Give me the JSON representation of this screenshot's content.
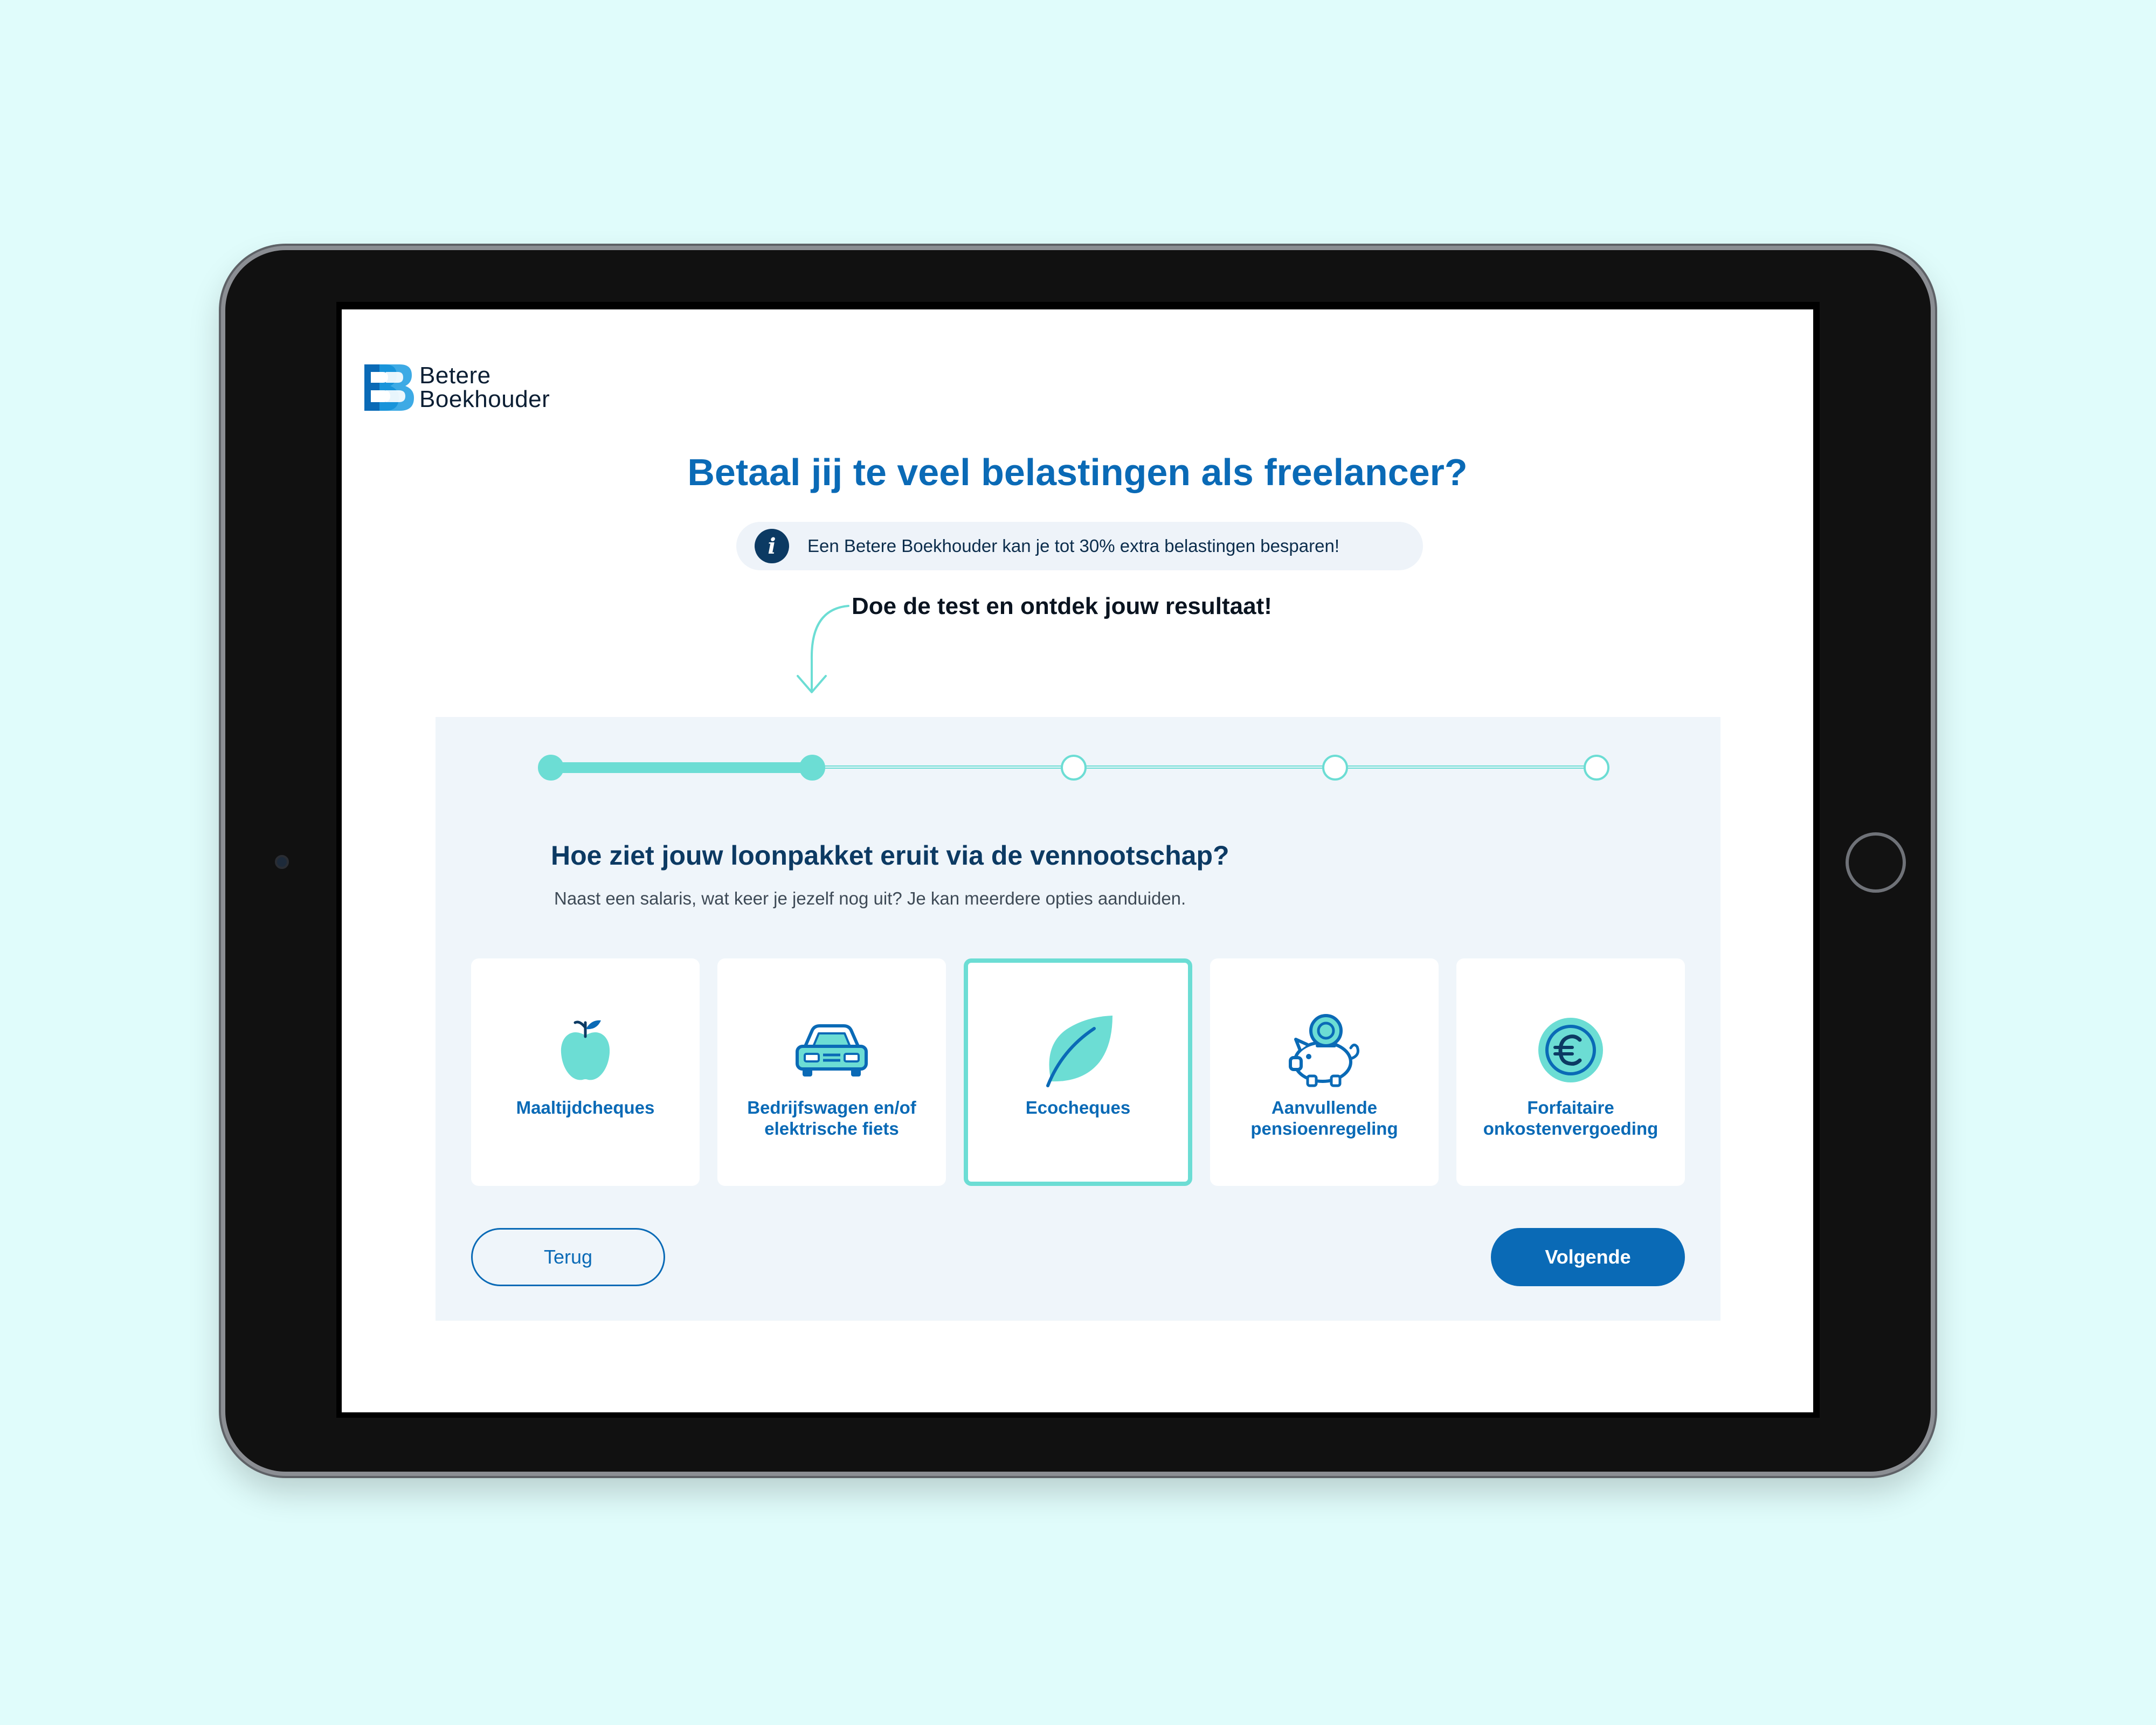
{
  "logo": {
    "line1": "Betere",
    "line2": "Boekhouder"
  },
  "headline": "Betaal jij te veel belastingen als freelancer?",
  "info": {
    "icon": "info-icon",
    "glyph": "i",
    "text": "Een Betere Boekhouder kan je tot 30% extra belastingen besparen!"
  },
  "cta": "Doe de test en ontdek jouw resultaat!",
  "progress": {
    "steps": 5,
    "current_step": 2
  },
  "question": {
    "title": "Hoe ziet jouw loonpakket eruit via de vennootschap?",
    "subtitle": "Naast een salaris, wat keer je jezelf nog uit? Je kan meerdere opties aanduiden."
  },
  "options": [
    {
      "label": "Maaltijdcheques",
      "icon": "apple-icon",
      "selected": false
    },
    {
      "label": "Bedrijfswagen en/of elektrische fiets",
      "icon": "car-icon",
      "selected": false
    },
    {
      "label": "Ecocheques",
      "icon": "leaf-icon",
      "selected": true
    },
    {
      "label": "Aanvullende pensioenregeling",
      "icon": "piggy-bank-icon",
      "selected": false
    },
    {
      "label": "Forfaitaire onkostenvergoeding",
      "icon": "euro-coin-icon",
      "selected": false
    }
  ],
  "buttons": {
    "back": "Terug",
    "next": "Volgende"
  },
  "colors": {
    "primary": "#0a6ab6",
    "accent": "#6cddd4",
    "dark": "#0c3a63",
    "background": "#e0fcfb",
    "panel": "#eff5fa"
  }
}
